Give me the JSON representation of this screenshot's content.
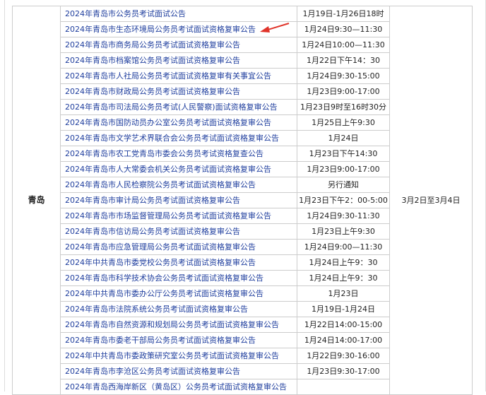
{
  "city": "青岛",
  "period": "3月2日至3月4日",
  "rows": [
    {
      "title": "2024年青岛市公务员考试面试公告",
      "time": "1月19日-1月26日18时"
    },
    {
      "title": "2024年青岛市生态环境局公务员考试面试资格复审公告",
      "time": "1月24日9:30—11:30"
    },
    {
      "title": "2024年青岛市商务局公务员考试面试资格复审公告",
      "time": "1月24日10:00—11:30"
    },
    {
      "title": "2024年青岛市档案馆公务员考试面试资格复审公告",
      "time": "1月22日下午14：30"
    },
    {
      "title": "2024年青岛市人社局公务员考试面试资格复审有关事宜公告",
      "time": "1月24日9:30-15:00"
    },
    {
      "title": "2024年青岛市财政局公务员考试面试资格复审公告",
      "time": "1月23日9:00-17:00"
    },
    {
      "title": "2024年青岛市司法局公务员考试(人民警察)面试资格复审公告",
      "time": "1月23日9时至16时30分"
    },
    {
      "title": "2024年青岛市国防动员办公室公务员考试面试资格复审公告",
      "time": "1月25日上午9:30"
    },
    {
      "title": "2024年青岛市文学艺术界联合会公务员考试面试资格复审公告",
      "time": "1月24日"
    },
    {
      "title": "2024年青岛市农工党青岛市委会公务员考试资格复查公告",
      "time": "1月23日下午14:30"
    },
    {
      "title": "2024年青岛市人大常委会机关公务员考试面试资格复审公告",
      "time": "1月23日9:00-17:00"
    },
    {
      "title": "2024年青岛市人民检察院公务员考试面试资格复审公告",
      "time": "另行通知"
    },
    {
      "title": "2024年青岛市审计局公务员考试面试资格复审公告",
      "time": "1月23日下午2：00-5:00"
    },
    {
      "title": "2024年青岛市市场监督管理局公务员考试面试资格复审公告",
      "time": "1月24日9:30-11:30"
    },
    {
      "title": "2024年青岛市信访局公务员考试面试资格复审公告",
      "time": "1月23日上午9:30"
    },
    {
      "title": "2024年青岛市应急管理局公务员考试面试资格复审公告",
      "time": "1月24日9:00—11:30"
    },
    {
      "title": "2024年中共青岛市委党校公务员考试面试资格复审公告",
      "time": "1月24日上午9：30"
    },
    {
      "title": "2024年青岛市科学技术协会公务员考试面试资格复审公告",
      "time": "1月24日上午9：30"
    },
    {
      "title": "2024年中共青岛市委办公厅公务员考试面试资格复审公告",
      "time": "1月23日"
    },
    {
      "title": "2024年青岛市法院系统公务员考试面试资格复审公告",
      "time": "1月19日-1月24日"
    },
    {
      "title": "2024年青岛市自然资源和规划局公务员考试面试资格复审公告",
      "time": "1月22日14:00-15:00"
    },
    {
      "title": "2024年青岛市委老干部局公务员考试面试资格复审公告",
      "time": "1月24日14:00-17:00"
    },
    {
      "title": "2024年中共青岛市委政策研究室公务员考试面试资格复审公告",
      "time": "1月22日9:30-16:00"
    },
    {
      "title": "2024年青岛市李沧区公务员考试面试资格复审公告",
      "time": "1月23日9:30-17:00"
    },
    {
      "title": "2024年青岛西海岸新区（黄岛区）公务员考试面试资格复审公告",
      "time": ""
    }
  ],
  "colors": {
    "link": "#1f3e9e",
    "arrow": "#e0342a",
    "border": "#cccccc"
  }
}
